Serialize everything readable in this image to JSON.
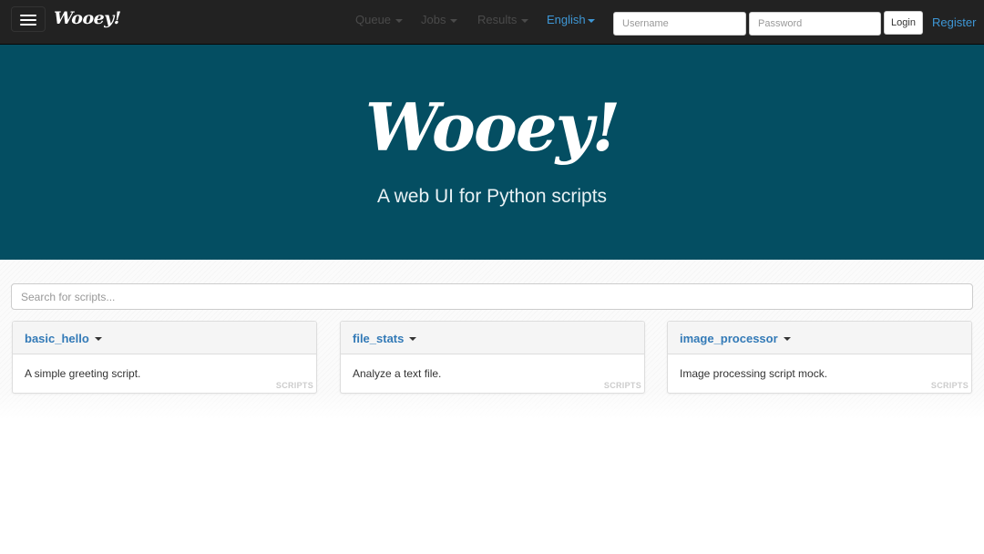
{
  "navbar": {
    "brand": "Wooey!",
    "menu_items": [
      {
        "label": "Queue",
        "icon": "caret-down-icon"
      },
      {
        "label": "Jobs",
        "icon": "caret-down-icon"
      },
      {
        "label": "Results",
        "icon": "caret-down-icon"
      }
    ],
    "language": "English",
    "username_placeholder": "Username",
    "password_placeholder": "Password",
    "login_label": "Login",
    "register_label": "Register"
  },
  "hero": {
    "logo": "Wooey!",
    "tagline": "A web UI for Python scripts"
  },
  "search": {
    "placeholder": "Search for scripts..."
  },
  "scripts": [
    {
      "name": "basic_hello",
      "description": "A simple greeting script.",
      "badge": "SCRIPTS"
    },
    {
      "name": "file_stats",
      "description": "Analyze a text file.",
      "badge": "SCRIPTS"
    },
    {
      "name": "image_processor",
      "description": "Image processing script mock.",
      "badge": "SCRIPTS"
    }
  ],
  "colors": {
    "navbar_bg": "#222222",
    "hero_bg": "#044e62",
    "link": "#337ab7",
    "nav_link_active": "#3e97d6"
  }
}
